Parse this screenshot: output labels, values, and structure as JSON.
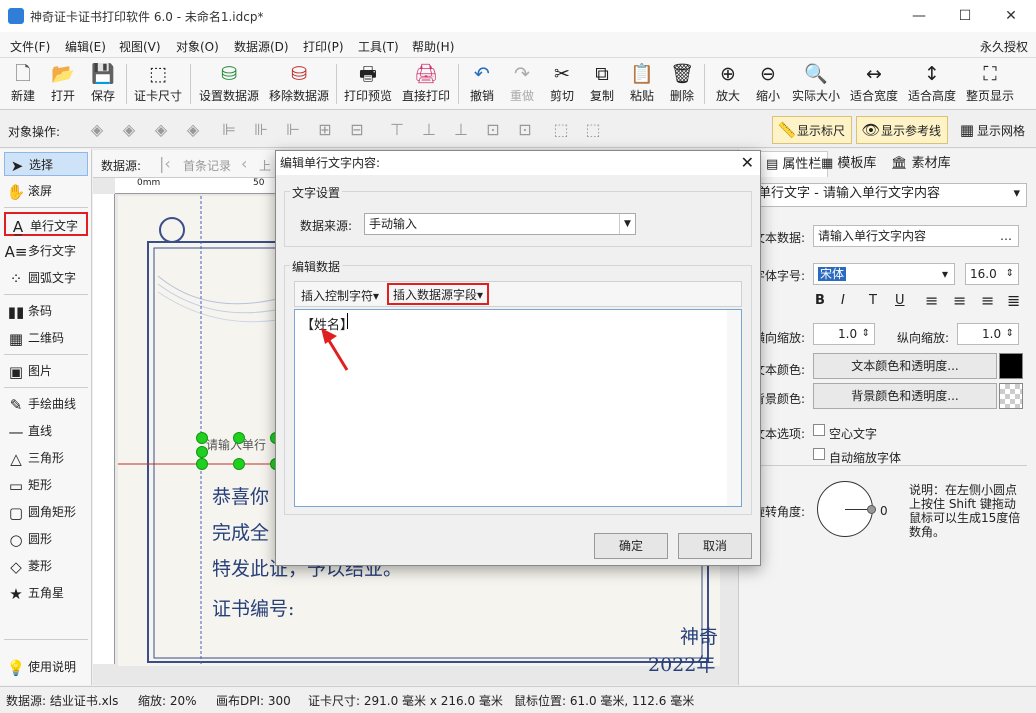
{
  "window": {
    "title": "神奇证卡证书打印软件 6.0 - 未命名1.idcp*",
    "min": "—",
    "max": "☐",
    "close": "✕"
  },
  "menu": [
    "文件(F)",
    "编辑(E)",
    "视图(V)",
    "对象(O)",
    "数据源(D)",
    "打印(P)",
    "工具(T)",
    "帮助(H)"
  ],
  "menu_right": "永久授权",
  "toolbar": [
    {
      "label": "新建",
      "icon": "🗋"
    },
    {
      "label": "打开",
      "icon": "📂"
    },
    {
      "label": "保存",
      "icon": "💾"
    },
    {
      "label": "证卡尺寸",
      "icon": "⬚"
    },
    {
      "label": "设置数据源",
      "icon": "⛁"
    },
    {
      "label": "移除数据源",
      "icon": "⛁"
    },
    {
      "label": "打印预览",
      "icon": "🖶"
    },
    {
      "label": "直接打印",
      "icon": "🖨"
    },
    {
      "label": "撤销",
      "icon": "↶"
    },
    {
      "label": "重做",
      "icon": "↷"
    },
    {
      "label": "剪切",
      "icon": "✂"
    },
    {
      "label": "复制",
      "icon": "⧉"
    },
    {
      "label": "粘贴",
      "icon": "📋"
    },
    {
      "label": "删除",
      "icon": "🗑"
    },
    {
      "label": "放大",
      "icon": "⊕"
    },
    {
      "label": "缩小",
      "icon": "⊖"
    },
    {
      "label": "实际大小",
      "icon": "🔍"
    },
    {
      "label": "适合宽度",
      "icon": "↔"
    },
    {
      "label": "适合高度",
      "icon": "↕"
    },
    {
      "label": "整页显示",
      "icon": "⛶"
    }
  ],
  "objbar": {
    "label": "对象操作:",
    "show_ruler": "显示标尺",
    "show_guides": "显示参考线",
    "show_grid": "显示网格"
  },
  "tools": [
    {
      "label": "选择",
      "icon": "➤"
    },
    {
      "label": "滚屏",
      "icon": "✋"
    },
    {
      "label": "单行文字",
      "icon": "A̲"
    },
    {
      "label": "多行文字",
      "icon": "A≡"
    },
    {
      "label": "圆弧文字",
      "icon": "⁘"
    },
    {
      "label": "条码",
      "icon": "▮▮"
    },
    {
      "label": "二维码",
      "icon": "▦"
    },
    {
      "label": "图片",
      "icon": "▣"
    },
    {
      "label": "手绘曲线",
      "icon": "✎"
    },
    {
      "label": "直线",
      "icon": "—"
    },
    {
      "label": "三角形",
      "icon": "△"
    },
    {
      "label": "矩形",
      "icon": "▭"
    },
    {
      "label": "圆角矩形",
      "icon": "▢"
    },
    {
      "label": "圆形",
      "icon": "○"
    },
    {
      "label": "菱形",
      "icon": "◇"
    },
    {
      "label": "五角星",
      "icon": "★"
    },
    {
      "label": "使用说明",
      "icon": "💡"
    }
  ],
  "nav": {
    "label": "数据源:",
    "first": "首条记录",
    "prev": "上"
  },
  "ruler": {
    "zero": "0mm",
    "fifty": "50"
  },
  "canvas": {
    "line1": "恭喜你",
    "line2": "完成全",
    "line3": "特发此证，予以结业。",
    "line4": "证书编号:",
    "line5": "神奇",
    "line6": "2022年",
    "selected_text": "请输入单行"
  },
  "right": {
    "tabs": [
      "属性栏",
      "模板库",
      "素材库"
    ],
    "object_select": "单行文字 - 请输入单行文字内容",
    "text_data_label": "文本数据:",
    "text_data": "请输入单行文字内容",
    "font_label": "字体字号:",
    "font": "宋体",
    "font_size": "16.0",
    "hscale_label": "横向缩放:",
    "hscale": "1.0",
    "vscale_label": "纵向缩放:",
    "vscale": "1.0",
    "text_color_label": "文本颜色:",
    "text_color_btn": "文本颜色和透明度...",
    "text_color": "#000000",
    "bg_color_label": "背景颜色:",
    "bg_color_btn": "背景颜色和透明度...",
    "options_label": "文本选项:",
    "hollow": "空心文字",
    "autoscale": "自动缩放字体",
    "rotate_label": "旋转角度:",
    "rotate_value": "0",
    "rotate_note": "说明：在左侧小圆点上按住 Shift 键拖动鼠标可以生成15度倍数角。"
  },
  "status": {
    "datasource": "数据源: 结业证书.xls",
    "zoom": "缩放: 20%",
    "dpi": "画布DPI: 300",
    "size": "证卡尺寸: 291.0 毫米 x 216.0 毫米",
    "mouse": "鼠标位置: 61.0 毫米, 112.6 毫米"
  },
  "dialog": {
    "title": "编辑单行文字内容:",
    "close": "✕",
    "group1": "文字设置",
    "source_label": "数据来源:",
    "source_value": "手动输入",
    "group2": "编辑数据",
    "insert_ctrl": "插入控制字符",
    "insert_field": "插入数据源字段",
    "content": "【姓名】",
    "ok": "确定",
    "cancel": "取消"
  }
}
